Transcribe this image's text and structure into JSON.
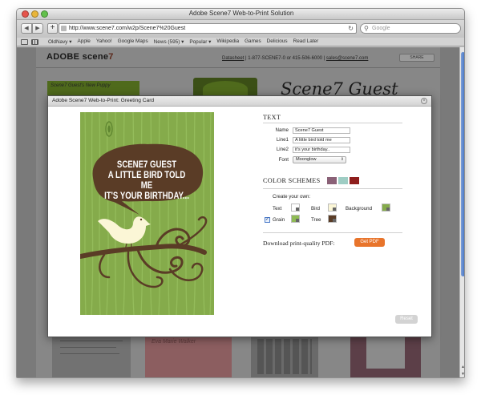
{
  "window": {
    "title": "Adobe Scene7 Web-to-Print Solution"
  },
  "toolbar": {
    "back": "◀",
    "forward": "▶",
    "add": "+",
    "url": "http://www.scene7.com/w2p/Scene7%20Guest",
    "search_placeholder": "Google"
  },
  "bookmarks": [
    "OldNavy ▾",
    "Apple",
    "Yahoo!",
    "Google Maps",
    "News (595) ▾",
    "Popular ▾",
    "Wikipedia",
    "Games",
    "Delicious",
    "Read Later"
  ],
  "site": {
    "logo_main": "ADOBE scene",
    "logo_seven": "7",
    "link_datasheet": "Datasheet",
    "phone": "1-877-SCENE7-0 or 415-506-6000",
    "email": "sales@scene7.com",
    "share": "SHARE",
    "thumb1_text": "Scene7 Guest's New Puppy",
    "thumb3_text": "Scene7 Guest",
    "bottom_thumb_text": "Eva Marie Walker"
  },
  "modal": {
    "title": "Adobe Scene7 Web-to-Print: Greeting Card",
    "card": {
      "line1": "SCENE7 GUEST",
      "line2": "A LITTLE BIRD TOLD ME",
      "line3": "IT'S YOUR BIRTHDAY..."
    },
    "text_section": {
      "title": "TEXT",
      "name_label": "Name",
      "name_value": "Scene7 Guest",
      "line1_label": "Line1",
      "line1_value": "A little bird told me",
      "line2_label": "Line2",
      "line2_value": "it's your birthday..",
      "font_label": "Font",
      "font_value": "Moonglow"
    },
    "color_schemes": {
      "title": "COLOR SCHEMES",
      "swatches": [
        "#8a6177",
        "#9fcdc4",
        "#8e1e1c"
      ],
      "create_label": "Create your own:",
      "text_label": "Text",
      "bird_label": "Bird",
      "background_label": "Background",
      "grain_label": "Grain",
      "grain_checked": true,
      "tree_label": "Tree",
      "text_color": "#ffffff",
      "bird_color": "#fbf6d6",
      "background_color": "#85ab4b",
      "grain_color": "#8fbb55",
      "tree_color": "#5a3c26"
    },
    "download_label": "Download print-quality PDF:",
    "getpdf_label": "Get PDF",
    "reset_label": "Reset"
  }
}
